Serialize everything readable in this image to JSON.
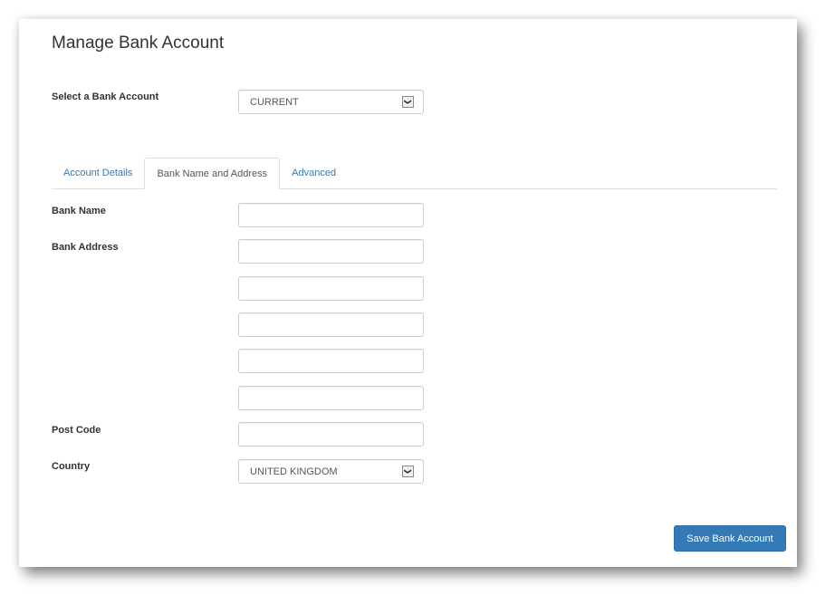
{
  "page": {
    "title": "Manage Bank Account"
  },
  "account_selector": {
    "label": "Select a Bank Account",
    "value": "CURRENT",
    "arrow_icon": "chevron-down-icon"
  },
  "tabs": [
    {
      "label": "Account Details",
      "active": false
    },
    {
      "label": "Bank Name and Address",
      "active": true
    },
    {
      "label": "Advanced",
      "active": false
    }
  ],
  "form": {
    "bank_name": {
      "label": "Bank Name",
      "value": ""
    },
    "bank_address": {
      "label": "Bank Address",
      "lines": [
        "",
        "",
        "",
        "",
        ""
      ]
    },
    "post_code": {
      "label": "Post Code",
      "value": ""
    },
    "country": {
      "label": "Country",
      "value": "UNITED KINGDOM"
    }
  },
  "actions": {
    "save_label": "Save Bank Account"
  },
  "colors": {
    "primary": "#337ab7",
    "link": "#337ab7",
    "border": "#cccccc"
  }
}
